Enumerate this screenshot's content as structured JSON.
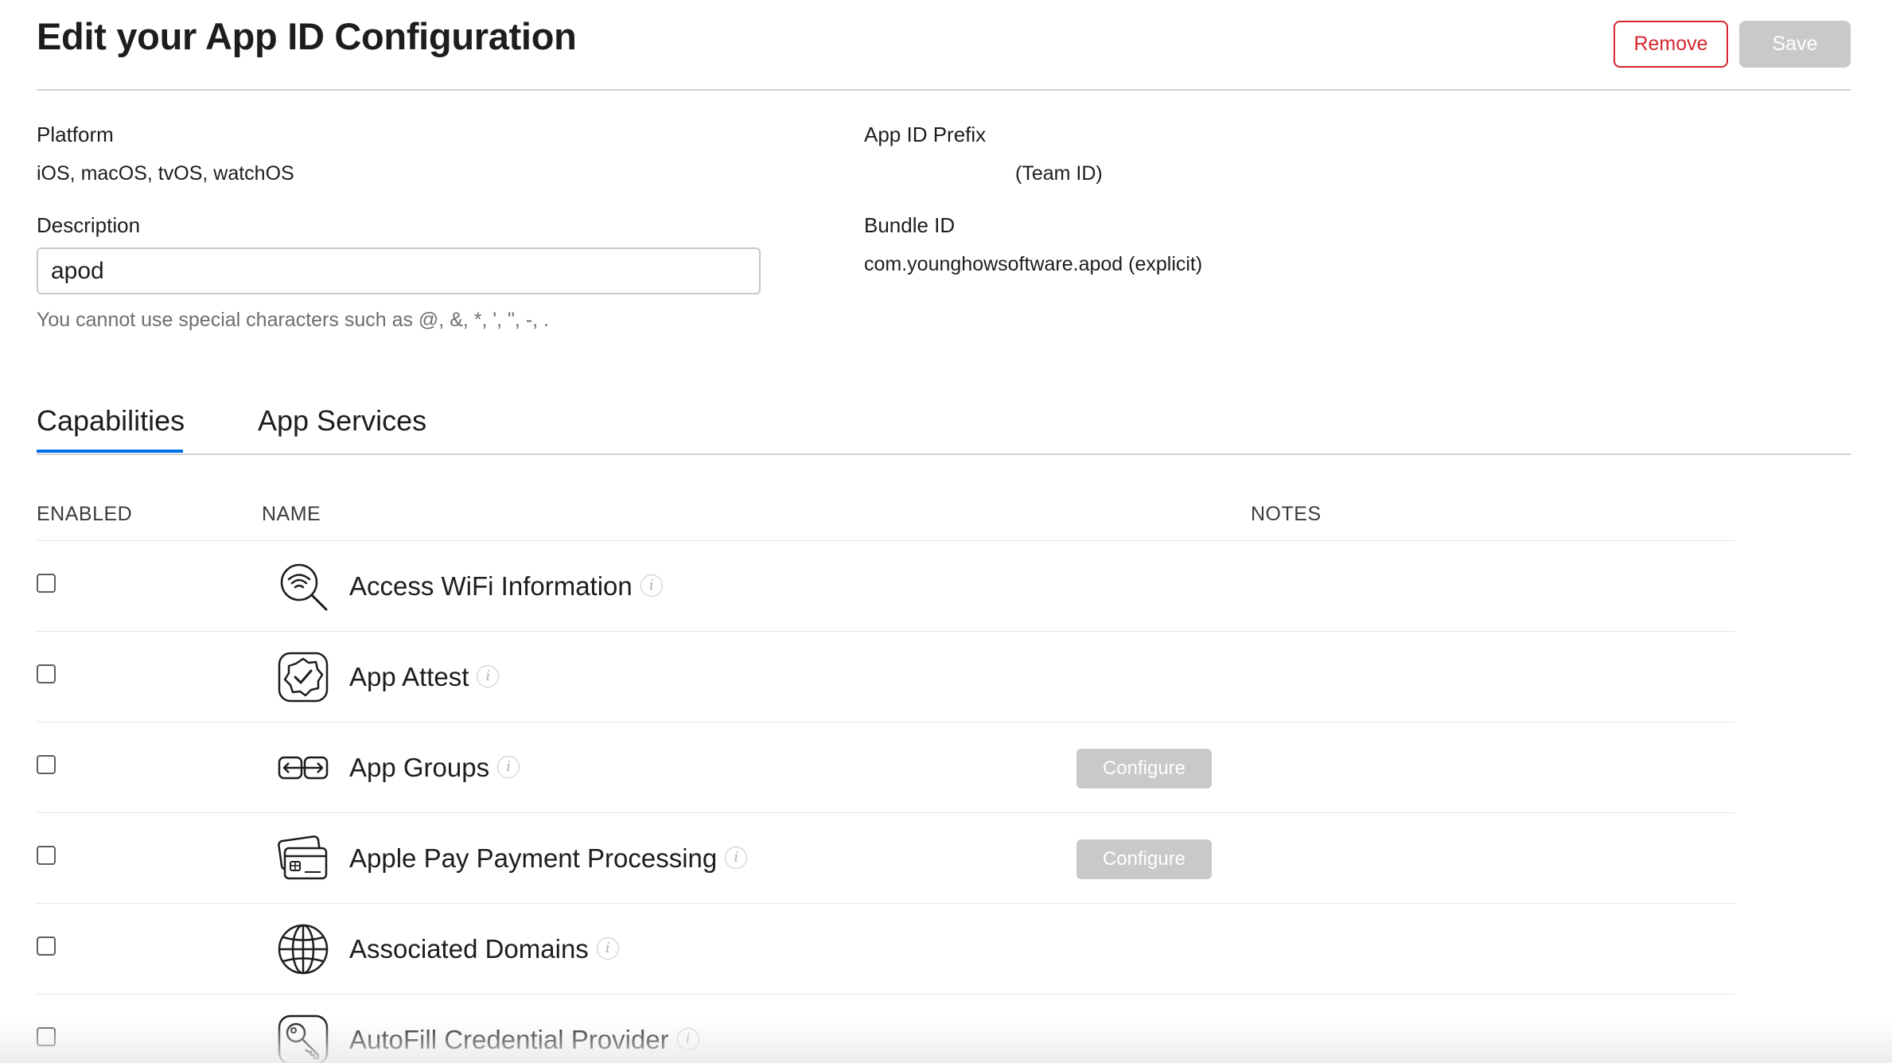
{
  "header": {
    "title": "Edit your App ID Configuration",
    "remove_label": "Remove",
    "save_label": "Save"
  },
  "platform": {
    "label": "Platform",
    "value": "iOS, macOS, tvOS, watchOS"
  },
  "prefix": {
    "label": "App ID Prefix",
    "value": "(Team ID)"
  },
  "description": {
    "label": "Description",
    "value": "apod",
    "hint": "You cannot use special characters such as @, &, *, ', \", -, ."
  },
  "bundle": {
    "label": "Bundle ID",
    "value": "com.younghowsoftware.apod (explicit)"
  },
  "tabs": [
    {
      "label": "Capabilities",
      "active": true
    },
    {
      "label": "App Services",
      "active": false
    }
  ],
  "table": {
    "headers": {
      "enabled": "ENABLED",
      "name": "NAME",
      "notes": "NOTES"
    },
    "rows": [
      {
        "name": "Access WiFi Information",
        "icon": "wifi-search-icon",
        "enabled": false,
        "configure": ""
      },
      {
        "name": "App Attest",
        "icon": "attest-badge-icon",
        "enabled": false,
        "configure": ""
      },
      {
        "name": "App Groups",
        "icon": "app-groups-icon",
        "enabled": false,
        "configure": "Configure"
      },
      {
        "name": "Apple Pay Payment Processing",
        "icon": "apple-pay-card-icon",
        "enabled": false,
        "configure": "Configure"
      },
      {
        "name": "Associated Domains",
        "icon": "globe-icon",
        "enabled": false,
        "configure": ""
      },
      {
        "name": "AutoFill Credential Provider",
        "icon": "key-icon",
        "enabled": false,
        "configure": ""
      }
    ]
  },
  "colors": {
    "accent": "#0071e3",
    "danger": "#d7262e",
    "disabled_button": "#c9c9cb"
  }
}
